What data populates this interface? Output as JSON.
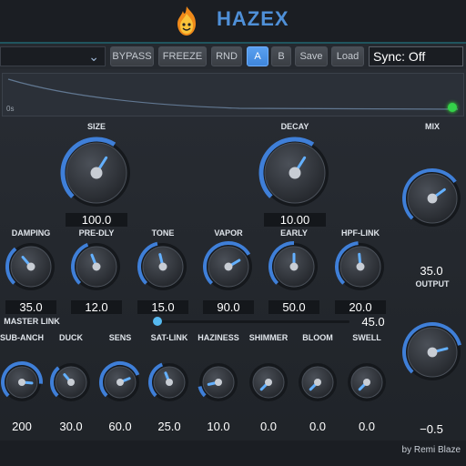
{
  "header": {
    "title": "HAZEX",
    "logo_icon": "flame-mascot-icon"
  },
  "toolbar": {
    "preset_value": "",
    "bypass": "BYPASS",
    "freeze": "FREEZE",
    "rnd": "RND",
    "a": "A",
    "b": "B",
    "save": "Save",
    "load": "Load",
    "sync": "Sync: Off",
    "active_slot": "A"
  },
  "display": {
    "time_label": "0s"
  },
  "big_knobs": {
    "size": {
      "label": "SIZE",
      "value": "100.0"
    },
    "decay": {
      "label": "DECAY",
      "value": "10.00"
    },
    "mix": {
      "label": "MIX"
    }
  },
  "row1": [
    {
      "label": "DAMPING",
      "value": "35.0"
    },
    {
      "label": "PRE-DLY",
      "value": "12.0"
    },
    {
      "label": "TONE",
      "value": "15.0"
    },
    {
      "label": "VAPOR",
      "value": "90.0"
    },
    {
      "label": "EARLY",
      "value": "50.0"
    },
    {
      "label": "HPF-LINK",
      "value": "20.0"
    }
  ],
  "output": {
    "mix_value": "35.0",
    "label": "OUTPUT",
    "value": "−0.5"
  },
  "master_link": {
    "label": "MASTER LINK",
    "value": "45.0",
    "level": 0.0
  },
  "row2": [
    {
      "label": "SUB-ANCH",
      "value": "200"
    },
    {
      "label": "DUCK",
      "value": "30.0"
    },
    {
      "label": "SENS",
      "value": "60.0"
    },
    {
      "label": "SAT-LINK",
      "value": "25.0"
    },
    {
      "label": "HAZINESS",
      "value": "10.0"
    },
    {
      "label": "SHIMMER",
      "value": "0.0"
    },
    {
      "label": "BLOOM",
      "value": "0.0"
    },
    {
      "label": "SWELL",
      "value": "0.0"
    }
  ],
  "footer": {
    "credit": "by Remi Blaze"
  },
  "colors": {
    "accent": "#4f90d8",
    "active": "#3f86db",
    "led": "#34d14a"
  }
}
